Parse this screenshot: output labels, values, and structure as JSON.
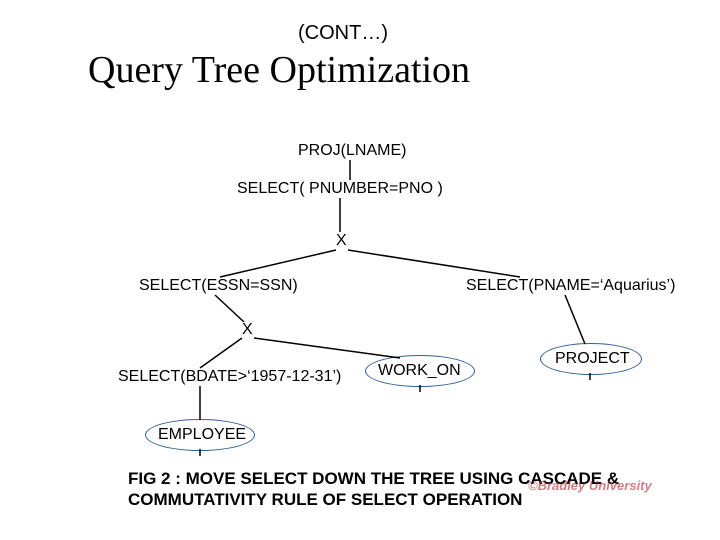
{
  "header": {
    "cont": "(CONT…)",
    "title": "Query Tree Optimization"
  },
  "nodes": {
    "proj": "PROJ(LNAME)",
    "sel_join1": "SELECT( PNUMBER=PNO )",
    "x1": "X",
    "sel_essn": "SELECT(ESSN=SSN)",
    "sel_pname": "SELECT(PNAME=‘Aquarius’)",
    "x2": "X",
    "sel_bdate": "SELECT(BDATE>‘1957-12-31’)",
    "work_on": "WORK_ON",
    "project": "PROJECT",
    "employee": "EMPLOYEE"
  },
  "caption": "FIG 2 : MOVE SELECT DOWN THE TREE USING CASCADE & COMMUTATIVITY RULE OF SELECT OPERATION",
  "footer": "©Bradley University"
}
